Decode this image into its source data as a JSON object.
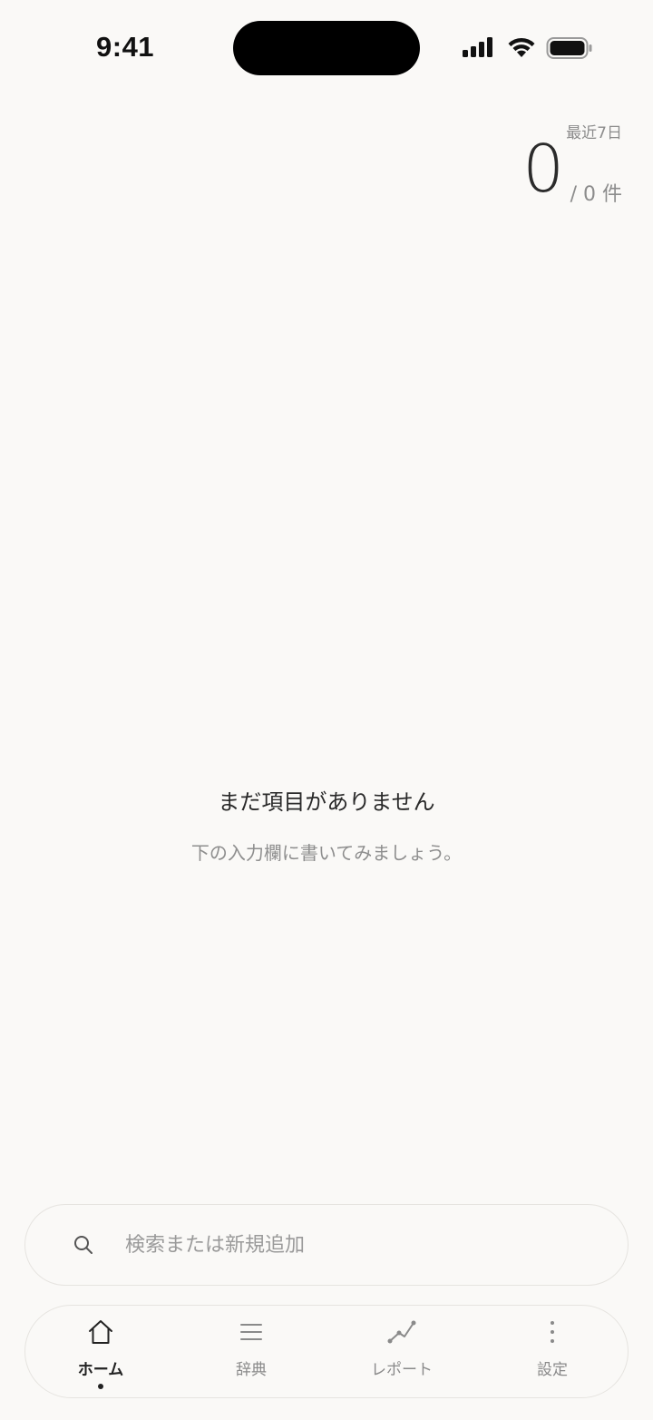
{
  "status_bar": {
    "time": "9:41"
  },
  "stats": {
    "label": "最近7日",
    "value": "0",
    "total": "/ 0 件"
  },
  "empty_state": {
    "title": "まだ項目がありません",
    "subtitle": "下の入力欄に書いてみましょう。"
  },
  "search": {
    "placeholder": "検索または新規追加"
  },
  "tabs": [
    {
      "label": "ホーム",
      "icon": "home-icon",
      "active": true
    },
    {
      "label": "辞典",
      "icon": "list-icon",
      "active": false
    },
    {
      "label": "レポート",
      "icon": "chart-line-icon",
      "active": false
    },
    {
      "label": "設定",
      "icon": "more-vertical-icon",
      "active": false
    }
  ]
}
